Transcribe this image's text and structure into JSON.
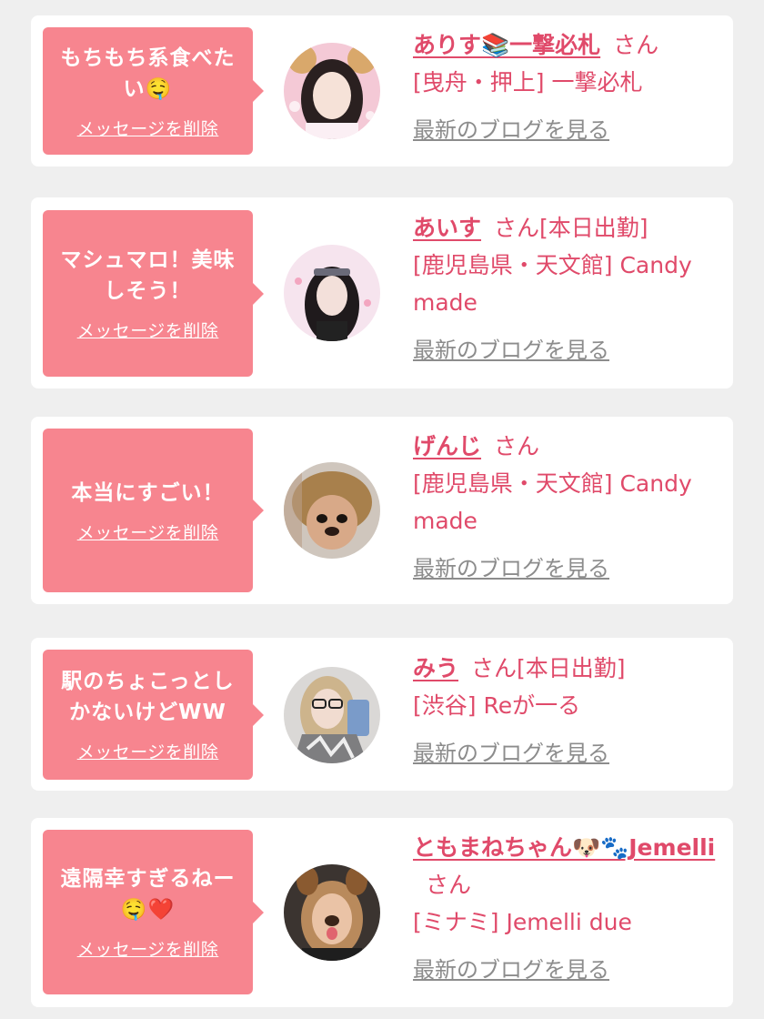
{
  "delete_label": "メッセージを削除",
  "blog_label": "最新のブログを見る",
  "honorific": "さん",
  "cards": [
    {
      "message": "もちもち系食べたい🤤",
      "name": "ありす📚一撃必札",
      "status": "",
      "shop": "[曳舟・押上] 一撃必札"
    },
    {
      "message": "マシュマロ！美味しそう！",
      "name": "あいす",
      "status": "[本日出勤]",
      "shop": "[鹿児島県・天文館] Candy made"
    },
    {
      "message": "本当にすごい！",
      "name": "げんじ",
      "status": "",
      "shop": "[鹿児島県・天文館] Candy made"
    },
    {
      "message": "駅のちょこっとしかないけどWW",
      "name": "みう",
      "status": "[本日出勤]",
      "shop": "[渋谷] Reが一る"
    },
    {
      "message": "遠隔幸すぎるねー🤤❤️",
      "name": "ともまねちゃん🐶🐾Jemelli",
      "status": "",
      "shop": "[ミナミ] Jemelli due"
    }
  ]
}
